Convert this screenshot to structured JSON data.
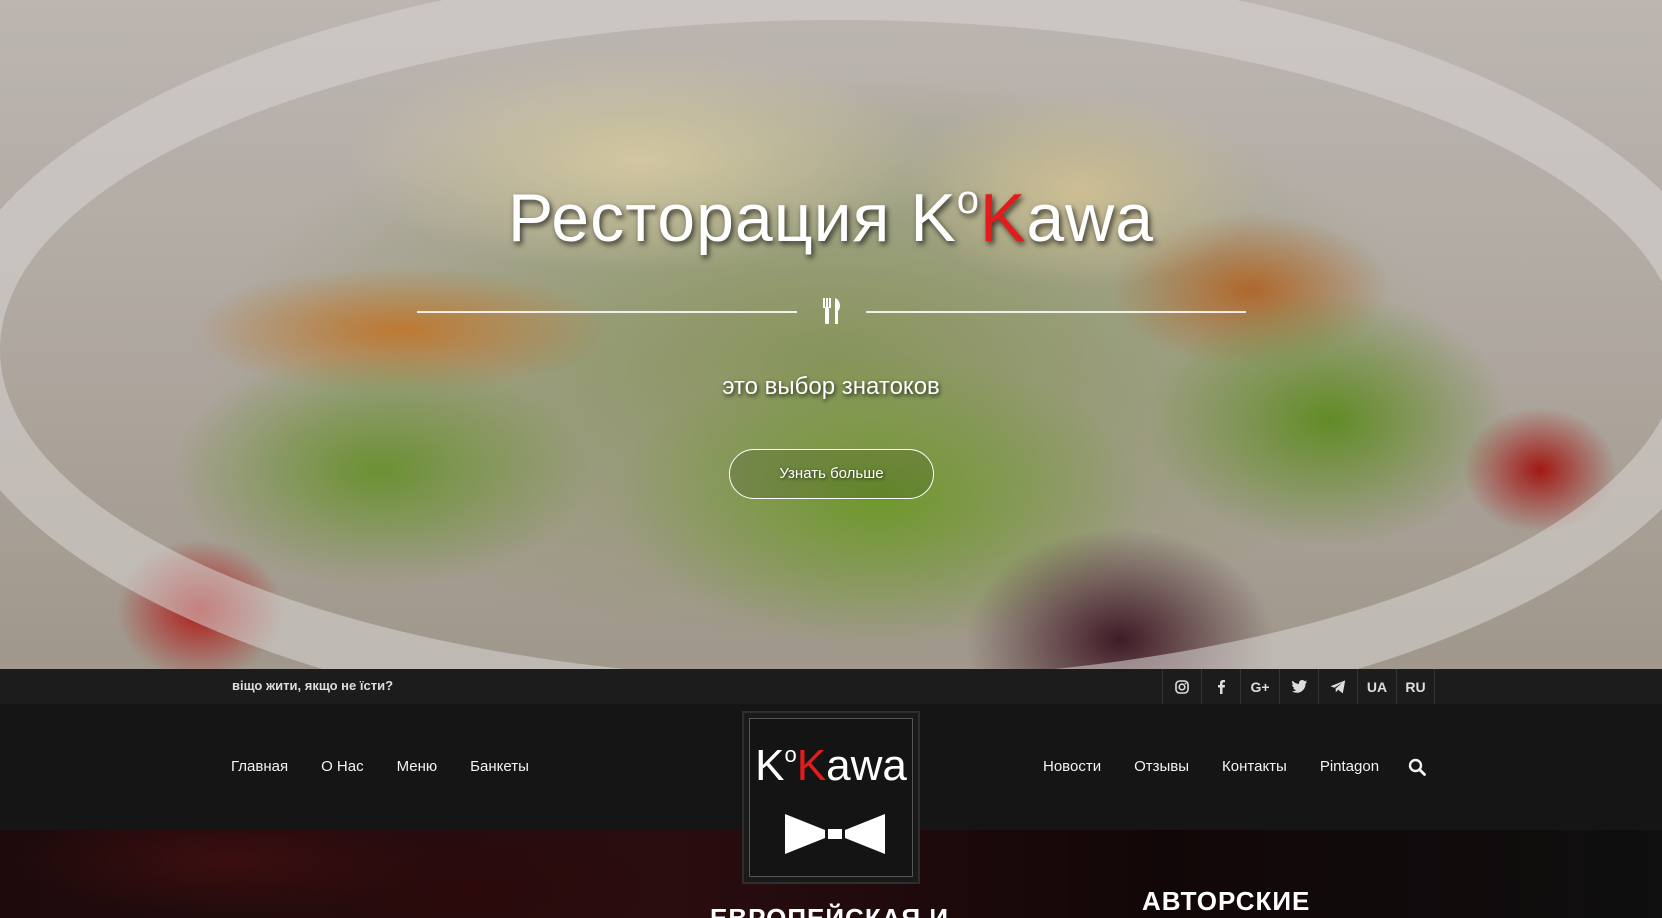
{
  "hero": {
    "title_prefix": "Реcтoрация K",
    "title_sup": "o",
    "title_k_red": "K",
    "title_suffix": "awa",
    "subtitle": "это выбор знатоков",
    "button_label": "Узнать больше",
    "icon": "cutlery-icon"
  },
  "topbar": {
    "tagline": "віщо жити, якщо не їсти?",
    "social": [
      {
        "icon": "instagram-icon"
      },
      {
        "icon": "facebook-icon"
      },
      {
        "icon": "google-plus-icon",
        "label": "G+"
      },
      {
        "icon": "twitter-icon"
      },
      {
        "icon": "telegram-icon"
      }
    ],
    "lang_ua": "UA",
    "lang_ru": "RU"
  },
  "nav": {
    "left": [
      "Главная",
      "О Нас",
      "Меню",
      "Банкеты"
    ],
    "right": [
      "Новости",
      "Отзывы",
      "Контакты",
      "Pintagon"
    ],
    "search_icon": "search-icon"
  },
  "logo": {
    "prefix": "K",
    "sup": "o",
    "k_red": "K",
    "suffix": "awa"
  },
  "lower": {
    "heading_left": "ЕВРОПЕЙСКАЯ И",
    "heading_right": "АВТОРСКИЕ"
  },
  "colors": {
    "accent_red": "#e41b1b",
    "nav_bg": "#151515",
    "topbar_bg": "#1c1c1c"
  }
}
